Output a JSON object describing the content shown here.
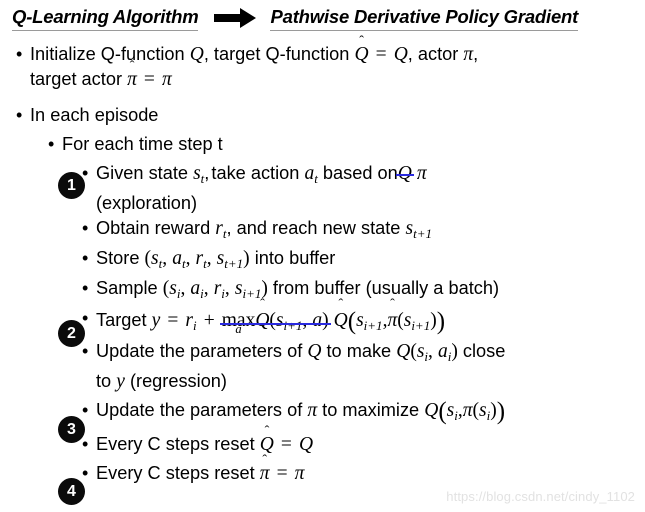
{
  "title": {
    "left_text": "Q-Learning Algorithm",
    "arrow_icon": "right-arrow-icon",
    "right_text": "Pathwise Derivative Policy Gradient"
  },
  "badges": [
    {
      "label": "1"
    },
    {
      "label": "2"
    },
    {
      "label": "3"
    },
    {
      "label": "4"
    }
  ],
  "bullet_glyph": "•",
  "lines": {
    "init_a": "Initialize Q-function Q, target Q-function Q̂ = Q, actor π,",
    "init_b": "target actor π̂ = π",
    "episode": "In each episode",
    "timestep": "For each time step t",
    "given_state_a": "Given state sₜ, take action aₜ based on Q π",
    "given_state_b": "(exploration)",
    "obtain_reward": "Obtain reward rₜ, and reach new state sₜ₊₁",
    "store": "Store (sₜ, aₜ, rₜ, sₜ₊₁) into buffer",
    "sample": "Sample (sᵢ, aᵢ, rᵢ, sᵢ₊₁) from buffer (usually a batch)",
    "target": "Target y = rᵢ + max_a Q̂(sᵢ₊₁, a) Q̂(sᵢ₊₁, π̂(sᵢ₊₁))",
    "update_q_a": "Update the parameters of Q to make Q(sᵢ, aᵢ) close",
    "update_q_b": "to y (regression)",
    "update_pi": "Update the parameters of π to maximize Q(sᵢ, π(sᵢ))",
    "reset_q": "Every C steps reset Q̂ = Q",
    "reset_pi": "Every C steps reset π̂ = π"
  },
  "tokens": {
    "Q": "Q",
    "Q_hat": "Q",
    "pi": "π",
    "pi_hat": "π",
    "hat_mark": "ˆ",
    "s": "s",
    "a": "a",
    "r": "r",
    "y": "y",
    "t": "t",
    "i": "i",
    "t1": "t+1",
    "i1": "i+1",
    "eq": "=",
    "plus": "+",
    "comma": ",",
    "max": "max",
    "lparen": "(",
    "rparen": ")",
    "lparen_big": "(",
    "rparen_big": ")",
    "text_init": "Initialize Q-function",
    "text_target_qfunc": ", target Q-function",
    "text_actor": ", actor",
    "text_target_actor": "target actor",
    "text_episode": "In each episode",
    "text_timestep": "For each time step t",
    "text_given_state": "Given state",
    "text_take_action": ", take action",
    "text_based_on": "based on",
    "text_exploration": "(exploration)",
    "text_obtain_reward": "Obtain reward",
    "text_and_reach": ", and reach new state",
    "text_store": "Store",
    "text_into_buffer": "into buffer",
    "text_sample": "Sample",
    "text_from_buffer": "from buffer (usually a batch)",
    "text_target": "Target",
    "text_update_params_of": "Update the parameters of",
    "text_to_make": "to make",
    "text_close": "close",
    "text_to": "to",
    "text_regression": "(regression)",
    "text_to_maximize": "to maximize",
    "text_every_c_reset": "Every C steps reset"
  },
  "watermark": "https://blog.csdn.net/cindy_1102",
  "colors": {
    "text": "#000000",
    "strikethrough": "#2a2ae0",
    "badge_background": "#0b0b0b",
    "badge_text": "#ffffff",
    "title_underline": "#9a9a9a",
    "watermark": "#e2e2e2",
    "background": "#ffffff"
  }
}
